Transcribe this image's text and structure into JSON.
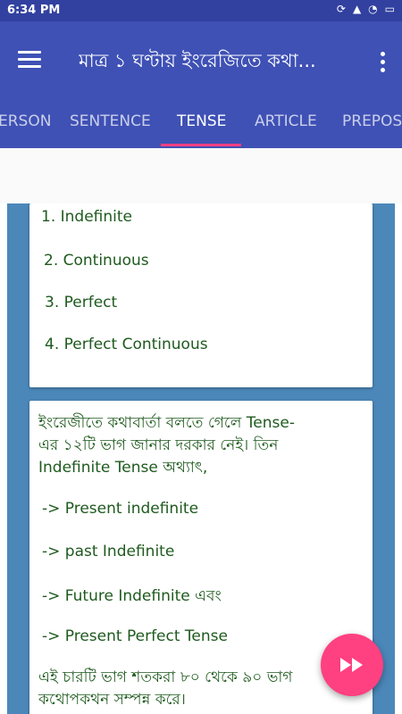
{
  "status": {
    "time": "6:34 PM"
  },
  "app_bar": {
    "title": "মাত্র ১ ঘণ্টায় ইংরেজিতে কথা..."
  },
  "tabs": [
    {
      "label": "ERSON"
    },
    {
      "label": "SENTENCE"
    },
    {
      "label": "TENSE",
      "active": true
    },
    {
      "label": "ARTICLE"
    },
    {
      "label": "PREPOS"
    }
  ],
  "card1": {
    "items": [
      "1. Indefinite",
      "2. Continuous",
      "3. Perfect",
      "4. Perfect Continuous"
    ]
  },
  "card2": {
    "intro_line1": "ইংরেজীতে কথাবার্তা বলতে গেলে Tense-",
    "intro_line2": "এর ১২টি ভাগ জানার দরকার নেই। তিন",
    "intro_line3": "Indefinite Tense অথ্যাৎ,",
    "items": [
      "-> Present indefinite",
      "-> past Indefinite",
      "-> Future Indefinite এবং",
      "-> Present Perfect Tense"
    ],
    "outro_line1": "এই চারটি ভাগ শতকরা ৮০ থেকে ৯০ ভাগ",
    "outro_line2": "কথোপকথন সম্পন্ন করে।"
  },
  "colors": {
    "primary": "#3f51b5",
    "accent": "#ff4081",
    "text_green": "#1e5a1e",
    "stripe": "#4b87b9"
  },
  "icons": {
    "menu": "menu-icon",
    "overflow": "more-vert-icon",
    "fab": "fast-forward-icon"
  }
}
